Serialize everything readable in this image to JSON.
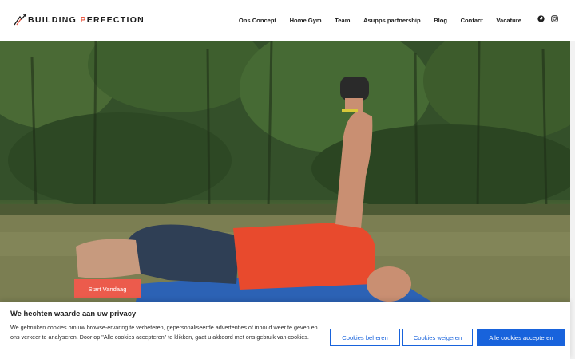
{
  "header": {
    "logo": {
      "word1": "BUILDING",
      "word2_accent": "P",
      "word2_rest": "ERFECTION",
      "icon": "arrows-logo-icon"
    },
    "nav": [
      "Ons Concept",
      "Home Gym",
      "Team",
      "Asupps partnership",
      "Blog",
      "Contact",
      "Vacature"
    ],
    "socials": [
      {
        "icon": "facebook-icon"
      },
      {
        "icon": "instagram-icon"
      }
    ]
  },
  "hero": {
    "cta_label": "Start Vandaag"
  },
  "cookie_banner": {
    "title": "We hechten waarde aan uw privacy",
    "text": "We gebruiken cookies om uw browse-ervaring te verbeteren, gepersonaliseerde advertenties of inhoud weer te geven en ons verkeer te analyseren. Door op \"Alle cookies accepteren\" te klikken, gaat u akkoord met ons gebruik van cookies.",
    "manage_label": "Cookies beheren",
    "reject_label": "Cookies weigeren",
    "accept_label": "Alle cookies accepteren"
  },
  "colors": {
    "accent": "#ec5b4c",
    "cookie_blue": "#1863dc",
    "text": "#1c1c1c"
  }
}
